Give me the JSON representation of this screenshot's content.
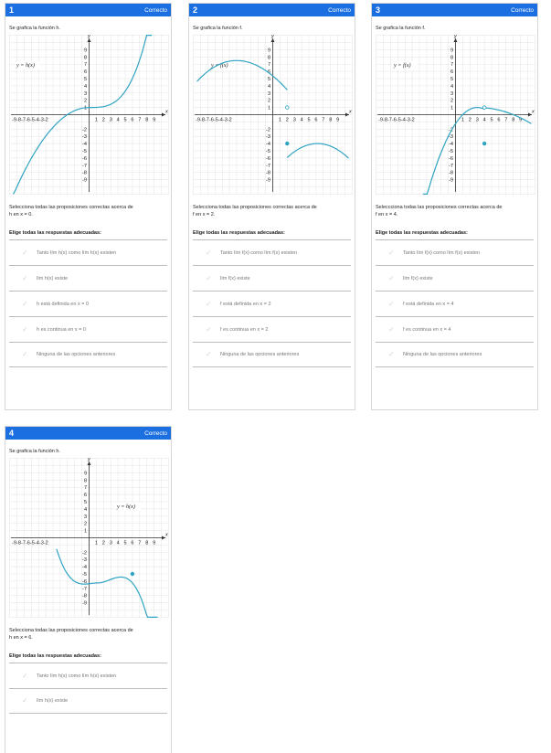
{
  "cards": [
    {
      "number": "1",
      "status": "Correcto",
      "intro": "Se grafica la función h.",
      "func_label": "y = h(x)",
      "prompt_1": "Selecciona todas las proposiciones correctas acerca de",
      "prompt_2": "h en x = 0.",
      "choose": "Elige todas las respuestas adecuadas:",
      "options": [
        "Tanto lím h(x) como lím h(x) existen",
        "lím h(x) existe",
        "h está definida en x = 0",
        "h es continua en x = 0",
        "Ninguna de las opciones anteriores"
      ]
    },
    {
      "number": "2",
      "status": "Correcto",
      "intro": "Se grafica la función f.",
      "func_label": "y = f(x)",
      "prompt_1": "Selecciona todas las proposiciones correctas acerca de",
      "prompt_2": "f en x = 2.",
      "choose": "Elige todas las respuestas adecuadas:",
      "options": [
        "Tanto lím f(x) como lím f(x) existen",
        "lím f(x) existe",
        "f está definida en x = 2",
        "f es continua en x = 2",
        "Ninguna de las opciones anteriores"
      ]
    },
    {
      "number": "3",
      "status": "Correcto",
      "intro": "Se grafica la función f.",
      "func_label": "y = f(x)",
      "prompt_1": "Seleccciona todas las proposiciones correctas acerca de",
      "prompt_2": "f en x = 4.",
      "choose": "Elige todas las respuestas adecuadas:",
      "options": [
        "Tanto lím f(x) como lím f(x) existen",
        "lím f(x) existe",
        "f está definida en x = 4",
        "f es continua en x = 4",
        "Ninguna de las opciones anteriores"
      ]
    },
    {
      "number": "4",
      "status": "Correcto",
      "intro": "Se grafica la función h.",
      "func_label": "y = h(x)",
      "prompt_1": "Selecciona todas las proposiciones correctas acerca de",
      "prompt_2": "h en x = 6.",
      "choose": "Elige todas las respuestas adecuadas:",
      "options": [
        "Tanto lím h(x) como lím h(x) existen",
        "lím h(x) existe"
      ]
    }
  ],
  "axis": {
    "x_label": "x",
    "y_label": "y",
    "neg_ticks": "-9-8-7-6-5-4-3-2",
    "pos_x_ticks": [
      "1",
      "2",
      "3",
      "4",
      "5",
      "6",
      "7",
      "8",
      "9"
    ],
    "pos_y_ticks": [
      "9",
      "8",
      "7",
      "6",
      "5",
      "4",
      "3",
      "2",
      "1"
    ],
    "neg_y_ticks": [
      "-2",
      "-3",
      "-4",
      "-5",
      "-6",
      "-7",
      "-8",
      "-9"
    ]
  },
  "colors": {
    "header": "#1c6fe0",
    "curve": "#2fa4c2",
    "grid": "#e3e3e3"
  },
  "icons": {
    "check": "check-icon"
  }
}
